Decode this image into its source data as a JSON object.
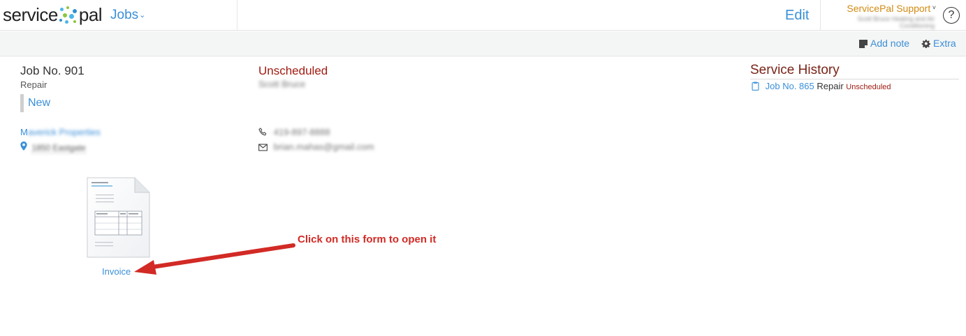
{
  "header": {
    "logo_left": "service",
    "logo_right": "pal",
    "module_menu": "Jobs",
    "edit_label": "Edit",
    "account_name": "ServicePal Support",
    "account_company": "Scott Bruce Heating and Air Conditioning",
    "help_glyph": "?"
  },
  "toolbar": {
    "add_note_label": "Add note",
    "extra_label": "Extra"
  },
  "job": {
    "number": "Job No. 901",
    "type": "Repair",
    "status": "New",
    "schedule_status": "Unscheduled",
    "technician": "Scott Bruce"
  },
  "customer": {
    "name_first_char": "M",
    "name_mid": "averick P",
    "name_last_char": "roperties",
    "address": "1850 Eastgate",
    "phone": "419-897-8888",
    "email": "brian.mahas@gmail.com"
  },
  "history": {
    "title": "Service History",
    "items": [
      {
        "link": "Job No. 865",
        "type": "Repair",
        "status": "Unscheduled"
      }
    ]
  },
  "forms": [
    {
      "label": "Invoice"
    }
  ],
  "annotation": {
    "callout": "Click on this form to open it",
    "color": "#d22a25"
  },
  "colors": {
    "link": "#3a8fd8",
    "status_red": "#a01c12",
    "account_orange": "#d18a12",
    "history_title": "#7a2317"
  },
  "icons": {
    "add_note": "note-icon",
    "extra": "gear-icon",
    "address": "map-pin-icon",
    "phone": "phone-icon",
    "email": "envelope-icon",
    "history_item": "clipboard-icon",
    "help": "help-icon"
  }
}
